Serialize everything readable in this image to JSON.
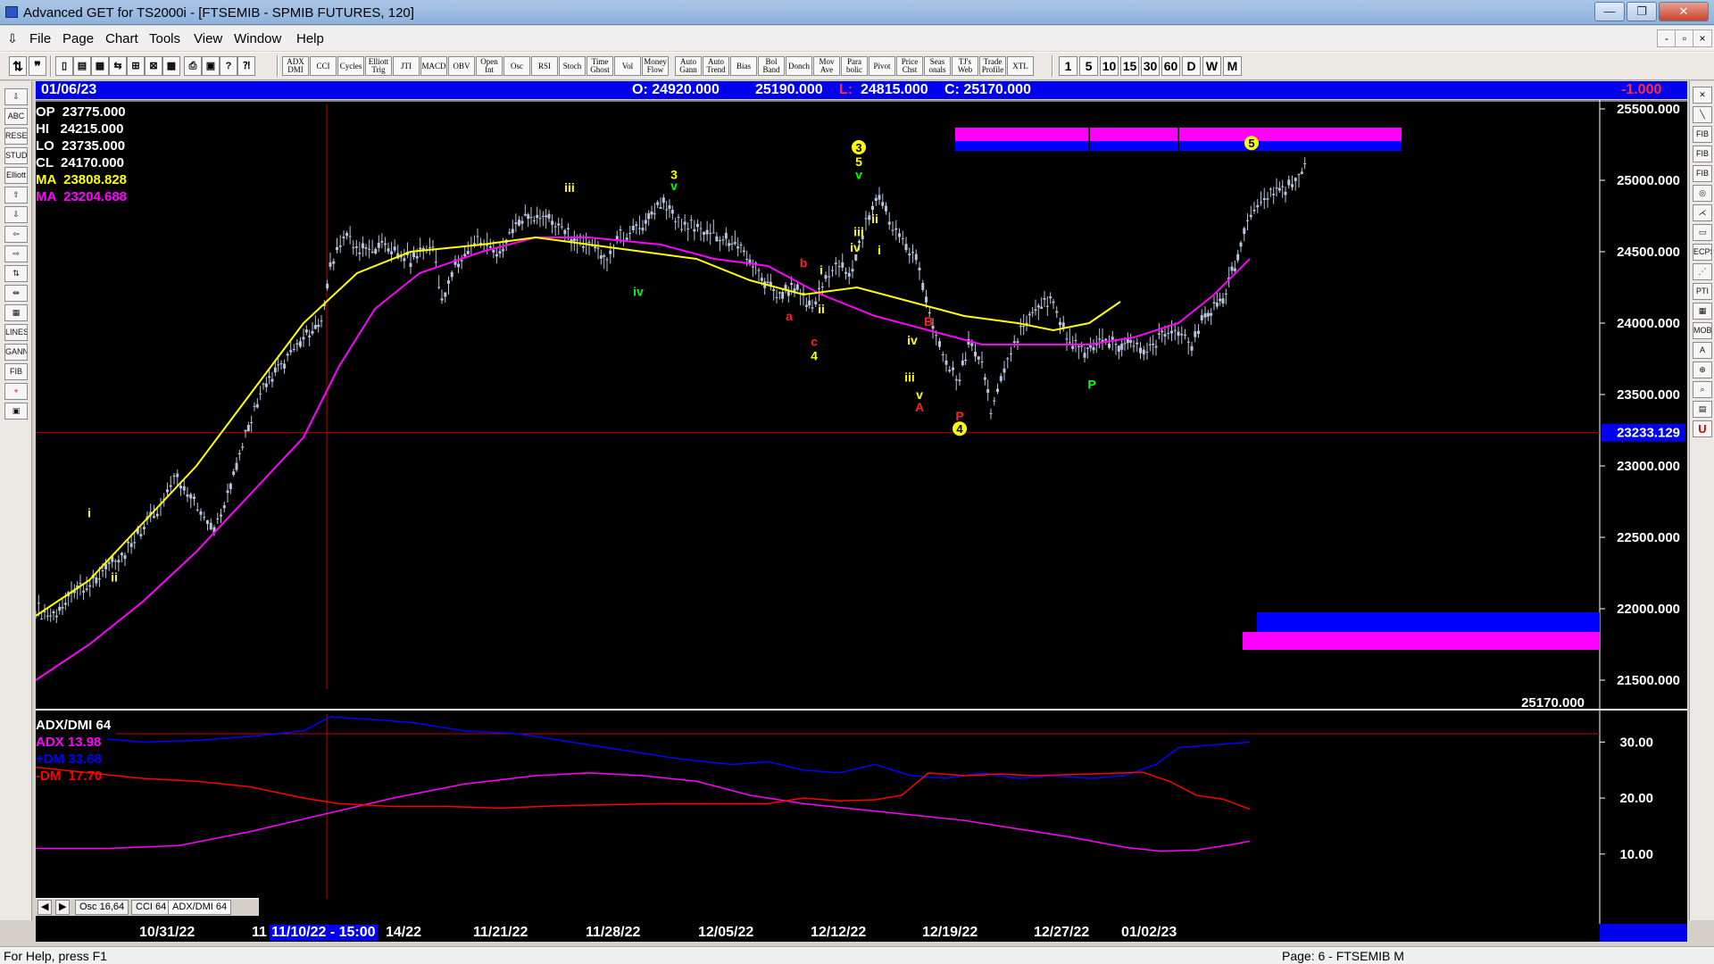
{
  "window": {
    "title": "Advanced GET for TS2000i - [FTSEMIB - SPMIB FUTURES, 120]",
    "min_label": "—",
    "max_label": "❐",
    "close_label": "✕"
  },
  "menu": {
    "items": [
      "File",
      "Page",
      "Chart",
      "Tools",
      "View",
      "Window",
      "Help"
    ],
    "mdi": [
      "-",
      "▫",
      "×"
    ]
  },
  "toolbar": {
    "studies": [
      "ADX DMI",
      "CCI",
      "Cycles",
      "Elliott Trig",
      "JTI",
      "MACD",
      "OBV",
      "Open Int",
      "Osc",
      "RSI",
      "Stoch",
      "Time Ghost",
      "Vol",
      "Money Flow",
      "Auto Gann",
      "Auto Trend",
      "Bias",
      "Bol Band",
      "Donch",
      "Mov Ave",
      "Para bolic",
      "Pivot",
      "Price Chst",
      "Seas onals",
      "TJ's Web",
      "Trade Profile",
      "XTL"
    ],
    "intervals": [
      "1",
      "5",
      "10",
      "15",
      "30",
      "60",
      "D",
      "W",
      "M"
    ]
  },
  "left_tools": [
    "⇩",
    "ABC",
    "RESET",
    "STUDY",
    "Elliott",
    "⇧",
    "⇩",
    "⇦",
    "⇨",
    "⇅",
    "⇹",
    "▦",
    "LINES",
    "GANN",
    "FIB",
    "+",
    "▣"
  ],
  "right_tools": [
    "✕",
    "╲",
    "FIB RET",
    "FIB EXT",
    "FIB TIME",
    "◎",
    "⋌",
    "▭",
    "ECPS",
    "⋰",
    "PTI",
    "▦",
    "MOB",
    "A",
    "⊕",
    "⌕",
    "▤",
    "U"
  ],
  "infobar": {
    "date": "01/06/23",
    "open": "O: 24920.000",
    "high": "25190.000",
    "low_label": "L:",
    "low": "24815.000",
    "close": "C: 25170.000",
    "change": "-1.000"
  },
  "legend": {
    "op": "OP  23775.000",
    "hi": "HI   24215.000",
    "lo": "LO  23735.000",
    "cl": "CL  24170.000",
    "ma1": "MA  23808.828",
    "ma2": "MA  23204.688"
  },
  "price_axis": {
    "ticks": [
      "25500.000",
      "25000.000",
      "24500.000",
      "24000.000",
      "23500.000",
      "23000.000",
      "22500.000",
      "22000.000",
      "21500.000"
    ],
    "cursor_value": "23233.129",
    "last_price": "25170.000"
  },
  "indicator": {
    "title": "ADX/DMI 64",
    "adx": "ADX 13.98",
    "pdm": "+DM 33.68",
    "mdm": "-DM  17.70",
    "ticks": [
      "30.00",
      "20.00",
      "10.00"
    ]
  },
  "wave_labels": [
    {
      "t": "i",
      "c": "#ffff00"
    },
    {
      "t": "ii",
      "c": "#ffff00"
    },
    {
      "t": "iii",
      "c": "#ffff00"
    },
    {
      "t": "3",
      "c": "#ffff00"
    },
    {
      "t": "v",
      "c": "#00ff00"
    },
    {
      "t": "iv",
      "c": "#00ff00"
    },
    {
      "t": "3",
      "c": "#ffff00"
    },
    {
      "t": "5",
      "c": "#ffff00"
    },
    {
      "t": "v",
      "c": "#00ff00"
    },
    {
      "t": "ii",
      "c": "#ffff00"
    },
    {
      "t": "iii",
      "c": "#ffff00"
    },
    {
      "t": "iv",
      "c": "#ffff00"
    },
    {
      "t": "i",
      "c": "#ffff00"
    },
    {
      "t": "b",
      "c": "#ff2020"
    },
    {
      "t": "i",
      "c": "#ffff00"
    },
    {
      "t": "a",
      "c": "#ff2020"
    },
    {
      "t": "ii",
      "c": "#ffff00"
    },
    {
      "t": "c",
      "c": "#ff2020"
    },
    {
      "t": "4",
      "c": "#ffff00"
    },
    {
      "t": "B",
      "c": "#ff2020"
    },
    {
      "t": "iv",
      "c": "#ffff00"
    },
    {
      "t": "iii",
      "c": "#ffff00"
    },
    {
      "t": "v",
      "c": "#ffff00"
    },
    {
      "t": "A",
      "c": "#ff2020"
    },
    {
      "t": "P",
      "c": "#ff2020"
    },
    {
      "t": "4",
      "c": "#ffff00"
    },
    {
      "t": "P",
      "c": "#00ff00"
    },
    {
      "t": "5",
      "c": "#ffff00"
    }
  ],
  "tabs": [
    "Osc 16,64",
    "CCI 64",
    "ADX/DMI 64"
  ],
  "tab_nav": [
    "◀",
    "▶"
  ],
  "datebar": {
    "dates": [
      "10/31/22",
      "11",
      "14/22",
      "11/21/22",
      "11/28/22",
      "12/05/22",
      "12/12/22",
      "12/19/22",
      "12/27/22",
      "01/02/23"
    ],
    "cursor": "11/10/22 - 15:00"
  },
  "status": {
    "help": "For Help, press F1",
    "page": "Page: 6 - FTSEMIB M"
  },
  "colors": {
    "ma_fast": "#ffff00",
    "ma_slow": "#ff00ff",
    "bars": "#b8c4dc",
    "adx": "#ff00ff",
    "plus_dm": "#0000ff",
    "minus_dm": "#ff0000",
    "zone_magenta": "#ff00ff",
    "zone_blue": "#0000ff"
  }
}
